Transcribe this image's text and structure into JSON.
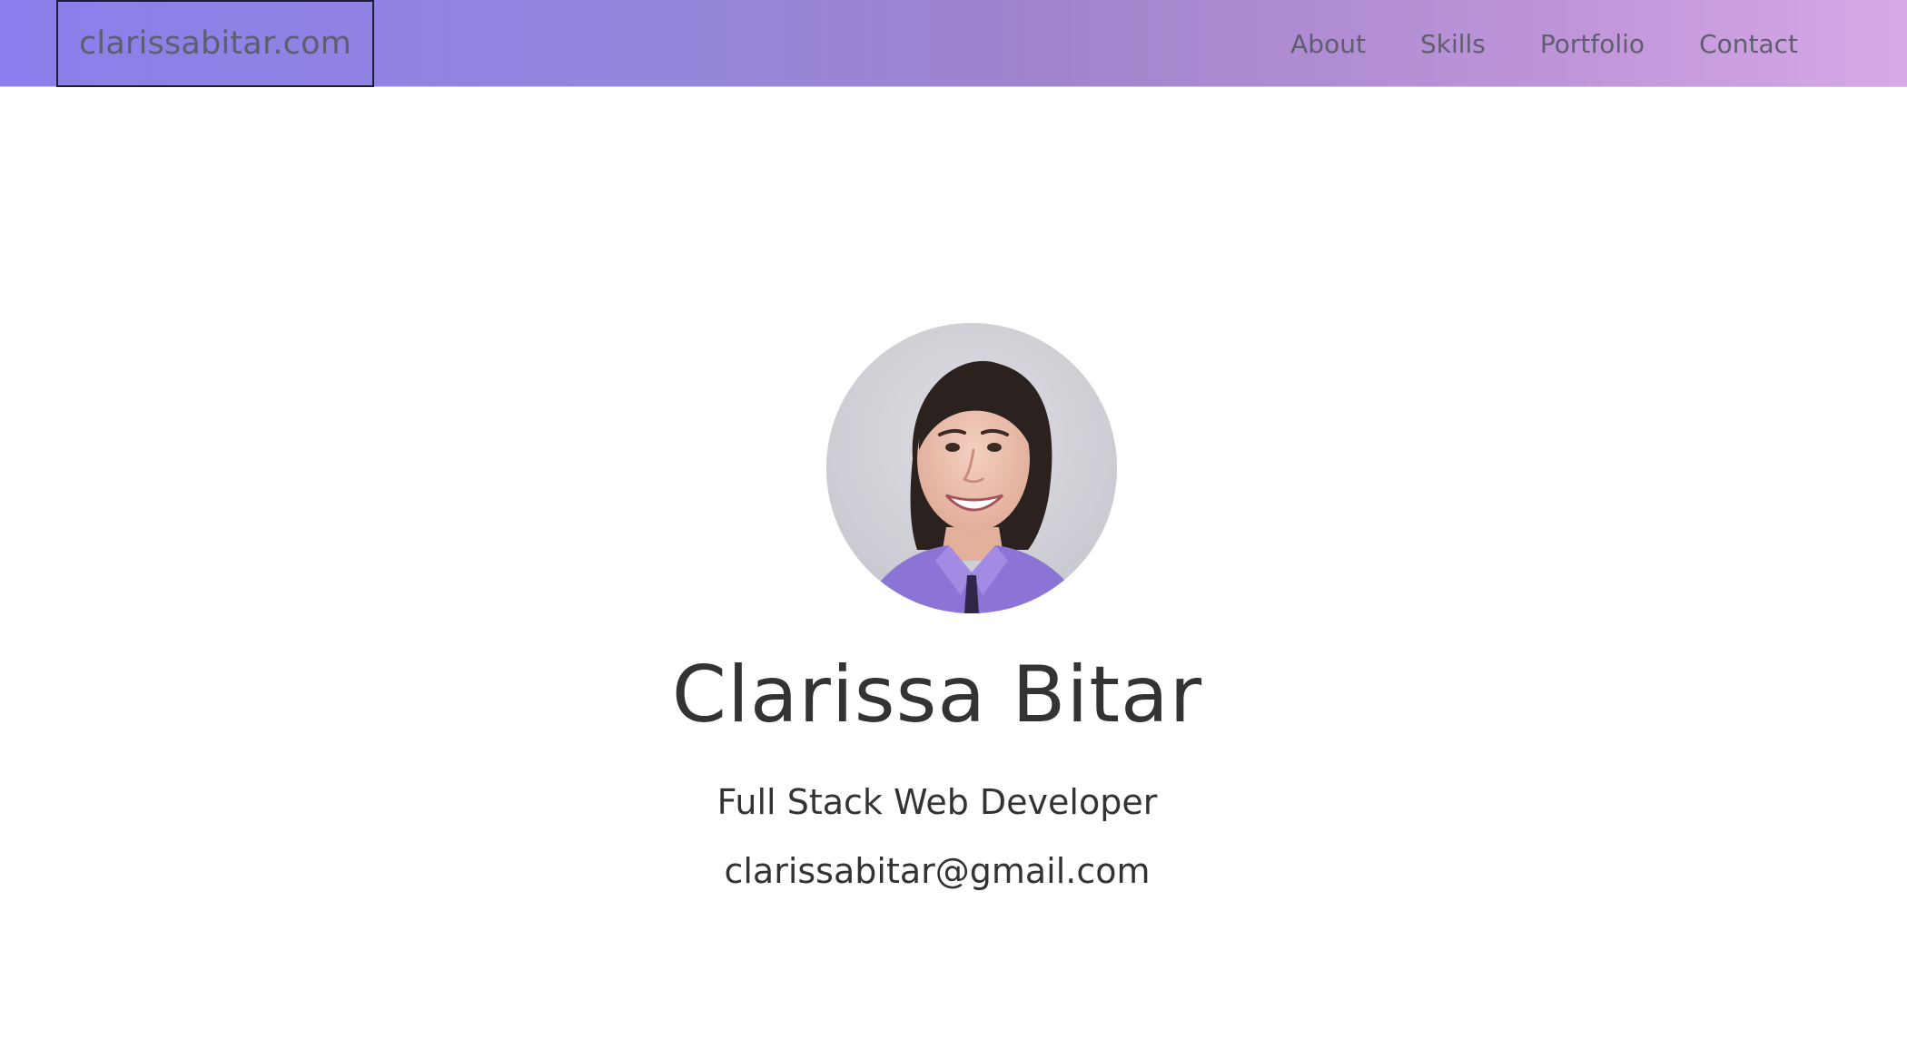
{
  "site": {
    "brand": "clarissabitar.com"
  },
  "nav": {
    "items": [
      {
        "label": "About"
      },
      {
        "label": "Skills"
      },
      {
        "label": "Portfolio"
      },
      {
        "label": "Contact"
      }
    ]
  },
  "hero": {
    "name": "Clarissa Bitar",
    "role": "Full Stack Web Developer",
    "email": "clarissabitar@gmail.com",
    "avatar_icon": "profile-photo"
  },
  "colors": {
    "nav_gradient_start": "#8a7fec",
    "nav_gradient_end": "#d7a9e6",
    "text": "#333333",
    "nav_text": "#5f5d6e"
  }
}
